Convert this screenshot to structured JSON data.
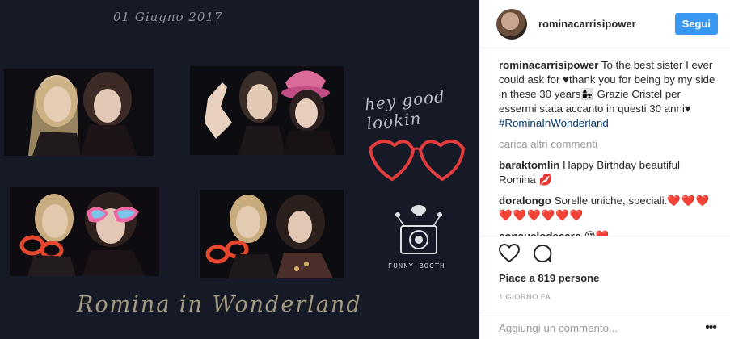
{
  "photo": {
    "date_text": "01 Giugno 2017",
    "title_text": "Romina in Wonderland",
    "side_text": "hey good lookin",
    "booth_text": "FUNNY BOOTH"
  },
  "post": {
    "username": "rominacarrisipower",
    "follow_label": "Segui",
    "caption_user": "rominacarrisipower",
    "caption_text_1": " To the best sister I ever could ask for ",
    "caption_heart": "♥",
    "caption_text_2": "thank you for being by my side in these 30 years",
    "caption_emoji": "👩‍👧",
    "caption_text_3": " Grazie Cristel per essermi stata accanto in questi 30 anni",
    "caption_heart2": "♥",
    "caption_tag": "#RominaInWonderland",
    "load_more": "carica altri commenti",
    "comments": [
      {
        "user": "baraktomlin",
        "text": " Happy Birthday beautiful Romina ",
        "emoji": "💋"
      },
      {
        "user": "doralongo",
        "text": " Sorelle uniche, speciali.",
        "emoji": "❤️❤️❤️❤️❤️❤️❤️❤️❤️"
      },
      {
        "user": "consuelodecaro",
        "text": " ",
        "emoji": "😍❤️"
      }
    ],
    "likes": "Piace a 819 persone",
    "time": "1 GIORNO FA",
    "add_comment_placeholder": "Aggiungi un commento...",
    "more_icon": "•••"
  },
  "icons": {
    "heart": "heart-icon",
    "comment": "comment-icon",
    "more": "more-options-icon"
  }
}
